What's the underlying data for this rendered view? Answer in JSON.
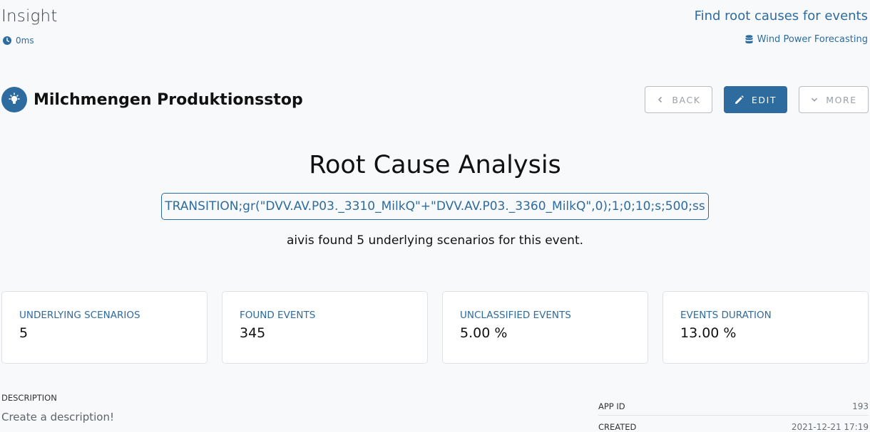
{
  "header": {
    "app_title": "Insight",
    "timer": "0ms",
    "page_context": "Find root causes for events",
    "project": "Wind Power Forecasting"
  },
  "insight": {
    "name": "Milchmengen Produktionsstop"
  },
  "actions": {
    "back": "BACK",
    "edit": "EDIT",
    "more": "MORE"
  },
  "analysis": {
    "title": "Root Cause Analysis",
    "definition": "TRANSITION;gr(\"DVV.AV.P03._3310_MilkQ\"+\"DVV.AV.P03._3360_MilkQ\",0);1;0;10;s;500;ss",
    "summary": "aivis found 5 underlying scenarios for this event."
  },
  "stats": [
    {
      "label": "UNDERLYING SCENARIOS",
      "value": "5"
    },
    {
      "label": "FOUND EVENTS",
      "value": "345"
    },
    {
      "label": "UNCLASSIFIED EVENTS",
      "value": "5.00 %"
    },
    {
      "label": "EVENTS DURATION",
      "value": "13.00 %"
    }
  ],
  "description": {
    "label": "DESCRIPTION",
    "placeholder": "Create a description!"
  },
  "meta": {
    "app_id_label": "APP ID",
    "app_id": "193",
    "created_label": "CREATED",
    "created": "2021-12-21 17:19"
  },
  "colors": {
    "accent": "#2e6b9e",
    "background": "#f8f9fb",
    "card_border": "#dfe2e6"
  },
  "icons": {
    "timer": "clock-icon",
    "project": "database-icon",
    "insight": "lightbulb-icon",
    "back": "chevron-left-icon",
    "edit": "pencil-icon",
    "more": "chevron-down-icon"
  }
}
